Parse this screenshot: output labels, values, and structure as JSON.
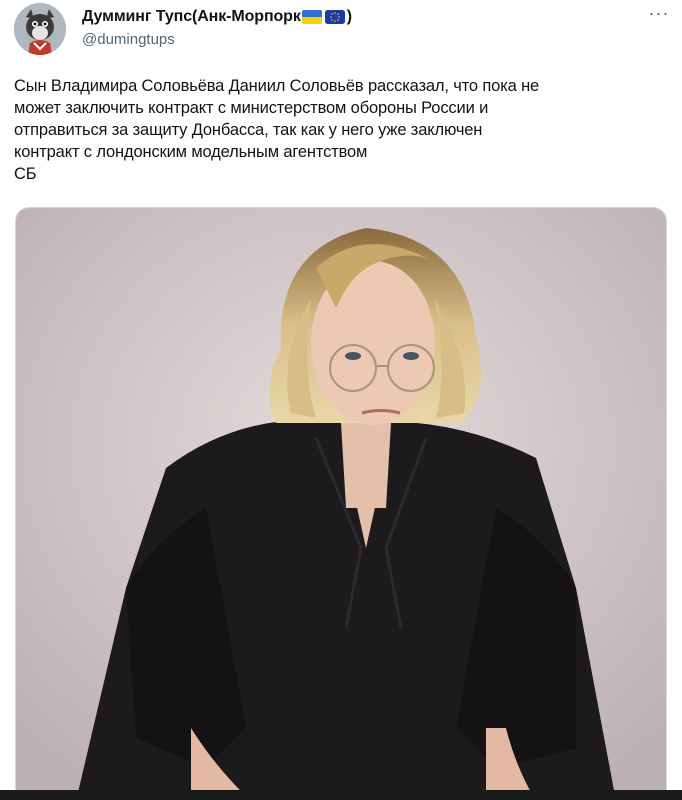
{
  "author": {
    "display_name": "Думминг Тупс(Анк-Морпорк",
    "closing_paren": ")",
    "handle": "@dumingtups",
    "flags": [
      "ukraine-flag",
      "eu-flag"
    ]
  },
  "tweet": {
    "text": "Сын Владимира Соловьёва Даниил Соловьёв рассказал, что пока не\nможет заключить контракт с министерством обороны России и\nотправиться за защиту Донбасса, так как у него уже заключен\nконтракт с лондонским модельным агентством\nСБ"
  },
  "menu": {
    "more_label": "···"
  },
  "media": {
    "description_icon": "photo"
  },
  "colors": {
    "text": "#0f1419",
    "secondary": "#536471",
    "background_photo": "#d8ced0"
  }
}
